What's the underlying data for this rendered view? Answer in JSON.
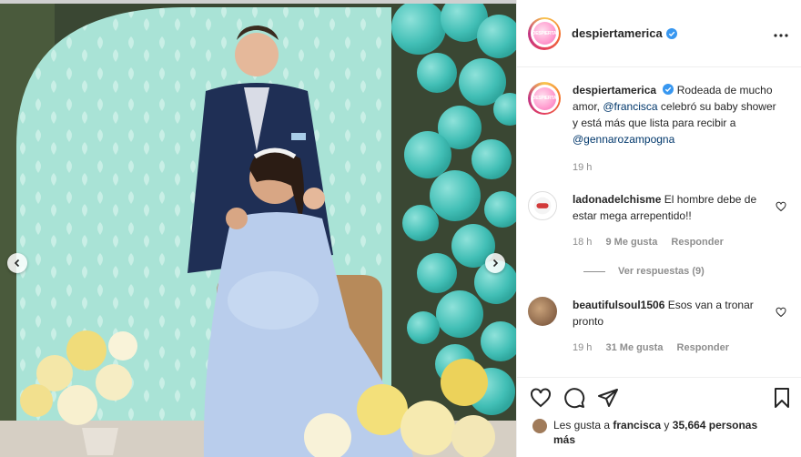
{
  "post": {
    "account": "despiertamerica",
    "avatar_text": "DESPIERTA"
  },
  "caption": {
    "user": "despiertamerica",
    "text_1": "Rodeada de mucho amor, ",
    "mention_1": "@francisca",
    "text_2": " celebró su baby shower y está más que lista para recibir a ",
    "mention_2": "@gennarozampogna",
    "time": "19 h"
  },
  "comments": [
    {
      "user": "ladonadelchisme",
      "text": "El hombre debe de estar mega arrepentido!!",
      "time": "18 h",
      "likes": "9 Me gusta",
      "reply": "Responder",
      "view_replies": "Ver respuestas (9)"
    },
    {
      "user": "beautifulsoul1506",
      "text": "Esos van a tronar pronto",
      "time": "19 h",
      "likes": "31 Me gusta",
      "reply": "Responder"
    }
  ],
  "likes": {
    "prefix": "Les gusta a ",
    "user": "francisca",
    "middle": " y ",
    "count": "35,664 personas más"
  },
  "colors": {
    "verified": "#3897f0",
    "mention": "#00376b",
    "meta": "#8e8e8e",
    "backdrop_mint": "#a9e3d6",
    "balloon_teal": "#4cc6bd",
    "dress_blue": "#b9cdec",
    "suit_navy": "#1f2f55"
  },
  "icons": [
    "more-icon",
    "verified-icon",
    "heart-icon",
    "comment-icon",
    "share-icon",
    "bookmark-icon",
    "chevron-left-icon",
    "chevron-right-icon"
  ]
}
